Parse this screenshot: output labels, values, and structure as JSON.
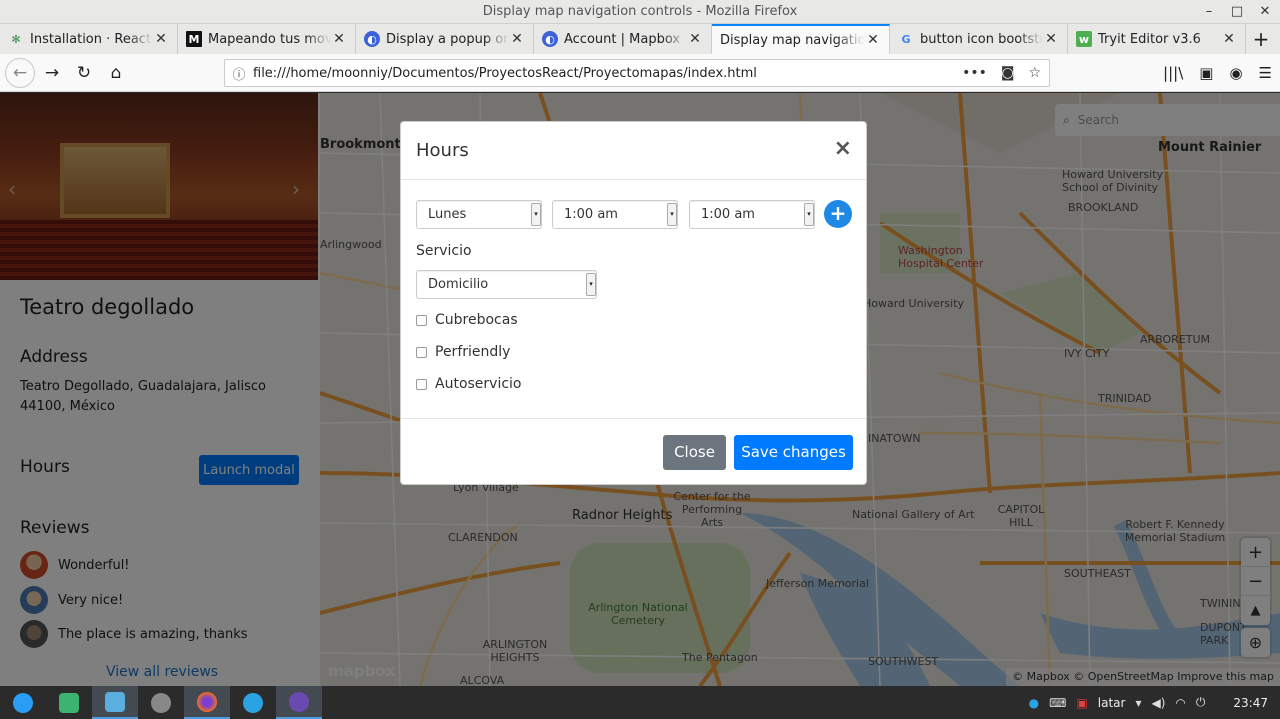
{
  "window": {
    "title": "Display map navigation controls - Mozilla Firefox"
  },
  "tabs": [
    {
      "label": "Installation · React"
    },
    {
      "label": "Mapeando tus mov"
    },
    {
      "label": "Display a popup on"
    },
    {
      "label": "Account | Mapbox"
    },
    {
      "label": "Display map navigatio"
    },
    {
      "label": "button icon bootstr"
    },
    {
      "label": "Tryit Editor v3.6"
    }
  ],
  "url": "file:///home/moonniy/Documentos/ProyectosReact/Proyectomapas/index.html",
  "sidebar": {
    "place_title": "Teatro degollado",
    "address_heading": "Address",
    "address_text": "Teatro Degollado, Guadalajara, Jalisco 44100, México",
    "hours_heading": "Hours",
    "launch_label": "Launch modal",
    "reviews_heading": "Reviews",
    "reviews": [
      {
        "text": "Wonderful!"
      },
      {
        "text": "Very nice!"
      },
      {
        "text": "The place is amazing, thanks"
      }
    ],
    "view_all": "View all reviews"
  },
  "map": {
    "search_placeholder": "Search",
    "attribution": "© Mapbox © OpenStreetMap  Improve this map",
    "logo": "mapbox",
    "labels": [
      {
        "text": "Brookmont"
      },
      {
        "text": "Mount Rainier"
      },
      {
        "text": "Howard University School of Divinity"
      },
      {
        "text": "BROOKLAND"
      },
      {
        "text": "Washington Hospital Center"
      },
      {
        "text": "Howard University"
      },
      {
        "text": "Arlingwood"
      },
      {
        "text": "ARBORETUM"
      },
      {
        "text": "IVY CITY"
      },
      {
        "text": "TRINIDAD"
      },
      {
        "text": "CHINATOWN"
      },
      {
        "text": "Lyon Village"
      },
      {
        "text": "Radnor Heights"
      },
      {
        "text": "National Gallery of Art"
      },
      {
        "text": "CAPITOL HILL"
      },
      {
        "text": "Robert F. Kennedy Memorial Stadium"
      },
      {
        "text": "Jefferson Memorial"
      },
      {
        "text": "Arlington National Cemetery"
      },
      {
        "text": "The Pentagon"
      },
      {
        "text": "ARLINGTON HEIGHTS"
      },
      {
        "text": "SOUTHEAST"
      },
      {
        "text": "SOUTHWEST"
      },
      {
        "text": "TWINING"
      },
      {
        "text": "DUPONT PARK"
      },
      {
        "text": "CLARENDON"
      },
      {
        "text": "ALCOVA"
      },
      {
        "text": "Center for the Performing Arts"
      }
    ]
  },
  "modal": {
    "title": "Hours",
    "close_icon": "×",
    "day_value": "Lunes",
    "start_value": "1:00 am",
    "end_value": "1:00 am",
    "service_label": "Servicio",
    "service_value": "Domicilio",
    "checkboxes": [
      {
        "label": "Cubrebocas"
      },
      {
        "label": "Perfriendly"
      },
      {
        "label": "Autoservicio"
      }
    ],
    "close_button": "Close",
    "save_button": "Save changes"
  },
  "taskbar": {
    "tray_text": "latar",
    "clock": "23:47"
  },
  "colors": {
    "primary": "#007bff",
    "secondary": "#6c757d",
    "plus_button": "#1e88e5",
    "tab_accent": "#0a84ff"
  }
}
